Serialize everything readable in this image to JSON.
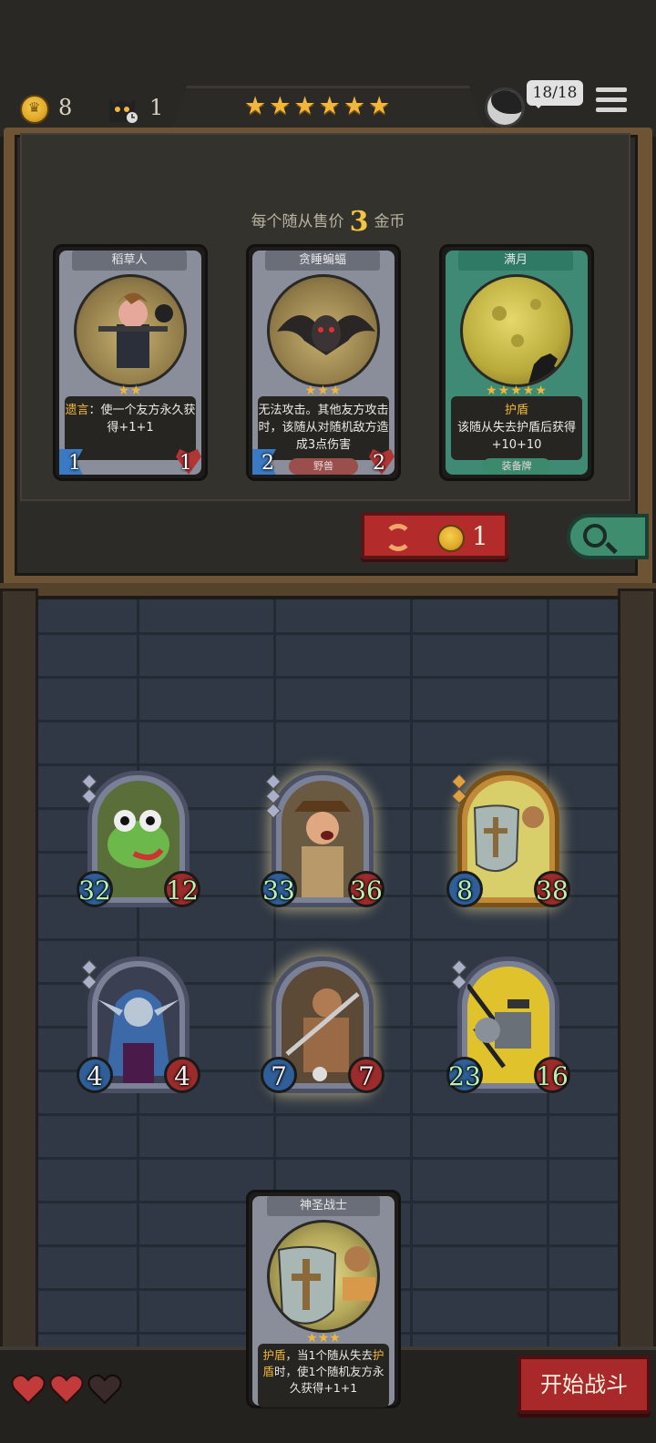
{
  "header": {
    "gold": "8",
    "turn": "1",
    "tavern_stars": [
      "★",
      "★",
      "★",
      "★",
      "★",
      "★"
    ],
    "health": "18/18"
  },
  "shop": {
    "sell_prefix": "每个随从售价",
    "sell_price": "3",
    "sell_suffix": "金币",
    "cards": [
      {
        "name": "稻草人",
        "stars": "★★",
        "desc_keyword": "遗言",
        "desc": "：使一个友方永久获得+1+1",
        "attack": "1",
        "health": "1",
        "tag": ""
      },
      {
        "name": "贪睡蝙蝠",
        "stars": "★★★",
        "desc_keyword": "",
        "desc": "无法攻击。其他友方攻击时，该随从对随机敌方造成3点伤害",
        "attack": "2",
        "health": "2",
        "tag": "野兽"
      },
      {
        "name": "满月",
        "stars": "★★★★★",
        "desc_keyword": "护盾",
        "desc": "该随从失去护盾后获得+10+10",
        "attack": "",
        "health": "",
        "tag": "装备牌"
      }
    ],
    "refresh_cost": "1"
  },
  "board": {
    "minions": [
      {
        "name": "frog",
        "attack": "32",
        "health": "12",
        "stars": 2
      },
      {
        "name": "adventurer",
        "attack": "33",
        "health": "36",
        "stars": 3
      },
      {
        "name": "holy-warrior",
        "attack": "8",
        "health": "38",
        "stars": 2
      },
      {
        "name": "elf",
        "attack": "4",
        "health": "4",
        "stars": 2
      },
      {
        "name": "barbarian",
        "attack": "7",
        "health": "7",
        "stars": 0
      },
      {
        "name": "robot",
        "attack": "23",
        "health": "16",
        "stars": 2
      }
    ]
  },
  "hand": {
    "name": "神圣战士",
    "stars": "★★★",
    "desc_keyword": "护盾",
    "desc_part1": "，当1个随从失去",
    "desc_keyword2": "护盾",
    "desc_part2": "时，使1个随机友方永久获得+1+1"
  },
  "footer": {
    "lives": 3,
    "lives_filled": 2,
    "start_label": "开始战斗"
  },
  "colors": {
    "gold": "#f2b73a",
    "attack_blue": "#2f5e98",
    "health_red": "#9c2b2b",
    "stat_green": "#b8f2b0",
    "button_red": "#a9282a",
    "search_green": "#3e8d6e"
  },
  "icons": [
    "coin-icon",
    "cat-turn-icon",
    "star-icon",
    "avatar-icon",
    "menu-icon",
    "refresh-icon",
    "search-icon",
    "heart-icon"
  ]
}
